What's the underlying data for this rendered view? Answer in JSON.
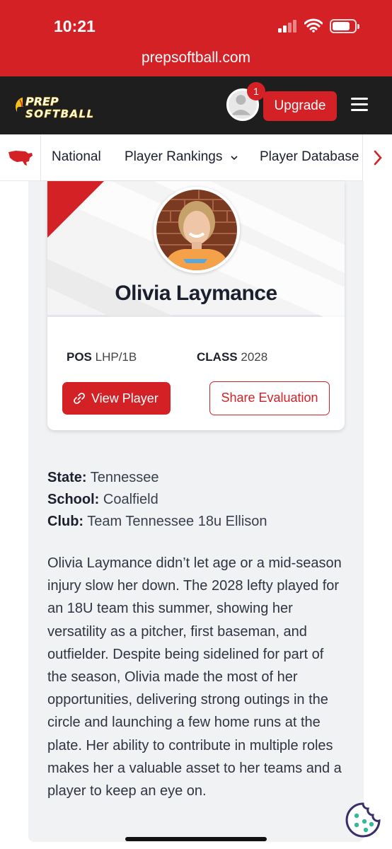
{
  "status_bar": {
    "time": "10:21"
  },
  "browser": {
    "url": "prepsoftball.com"
  },
  "header": {
    "logo_line1": "PREP",
    "logo_line2": "SOFTBALL",
    "notification_count": "1",
    "upgrade_label": "Upgrade",
    "icons": [
      "avatar",
      "menu-icon"
    ]
  },
  "nav": {
    "items": [
      {
        "label": "National"
      },
      {
        "label": "Player Rankings"
      },
      {
        "label": "Player Database"
      }
    ],
    "icons": [
      "usa-map-icon",
      "chevron-down-icon",
      "chevron-right-icon"
    ]
  },
  "player": {
    "name": "Olivia Laymance",
    "pos_label": "POS",
    "pos_value": "LHP/1B",
    "class_label": "CLASS",
    "class_value": "2028",
    "view_label": "View Player",
    "share_label": "Share Evaluation"
  },
  "details": {
    "state_label": "State:",
    "state_value": "Tennessee",
    "school_label": "School:",
    "school_value": "Coalfield",
    "club_label": "Club:",
    "club_value": "Team Tennessee 18u Ellison"
  },
  "bio": "Olivia Laymance didn’t let age or a mid-season injury slow her down. The 2028 lefty played for an 18U team this summer, showing her versatility as a pitcher, first baseman, and outfielder. Despite being sidelined for part of the season, Olivia made the most of her opportunities, delivering strong outings in the circle and launching a few home runs at the plate. Her ability to contribute in multiple roles makes her a valuable asset to her teams and a player to keep an eye on.",
  "colors": {
    "brand_red": "#d42126",
    "header_dark": "#1e1e1e",
    "page_bg": "#f1f2f4"
  }
}
